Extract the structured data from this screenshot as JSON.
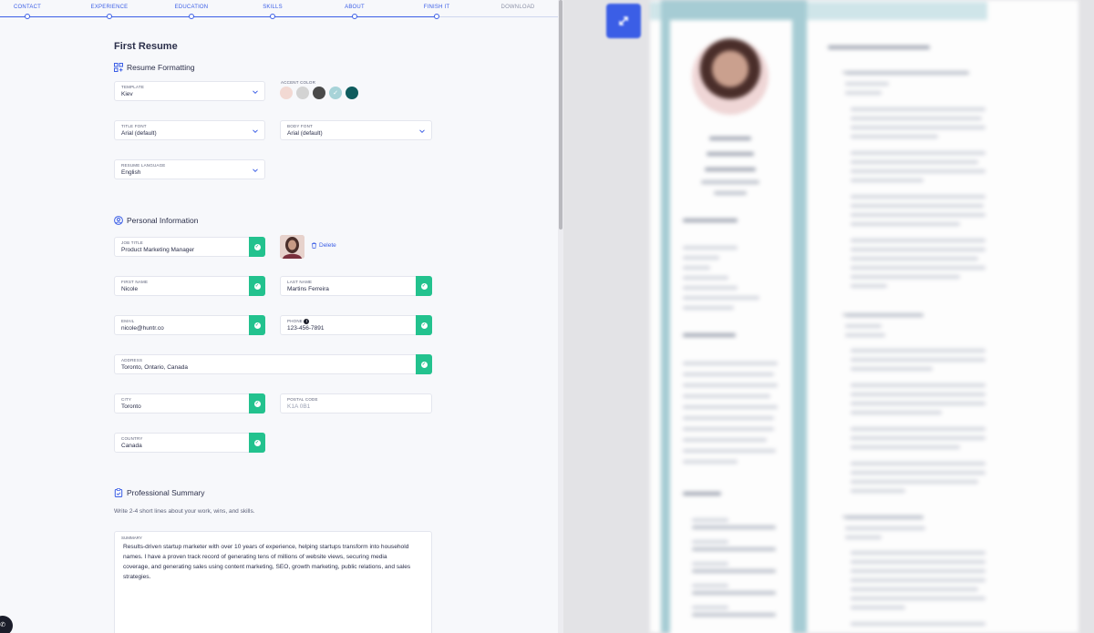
{
  "steps": [
    {
      "label": "CONTACT",
      "done": true
    },
    {
      "label": "EXPERIENCE",
      "done": true
    },
    {
      "label": "EDUCATION",
      "done": true
    },
    {
      "label": "SKILLS",
      "done": true
    },
    {
      "label": "ABOUT",
      "done": true
    },
    {
      "label": "FINISH IT",
      "done": true
    },
    {
      "label": "DOWNLOAD",
      "done": false
    }
  ],
  "page_title": "First Resume",
  "formatting": {
    "heading": "Resume Formatting",
    "template": {
      "label": "TEMPLATE",
      "value": "Kiev"
    },
    "accent": {
      "label": "ACCENT COLOR",
      "colors": [
        "#f2d9d3",
        "#d3d3d3",
        "#4a4a4a",
        "#a7d3d8",
        "#0f5c5e"
      ],
      "selected_index": 3
    },
    "title_font": {
      "label": "TITLE FONT",
      "value": "Arial (default)"
    },
    "body_font": {
      "label": "BODY FONT",
      "value": "Arial (default)"
    },
    "language": {
      "label": "RESUME LANGUAGE",
      "value": "English"
    }
  },
  "personal": {
    "heading": "Personal Information",
    "job_title": {
      "label": "JOB TITLE",
      "value": "Product Marketing Manager"
    },
    "delete_label": "Delete",
    "first_name": {
      "label": "FIRST NAME",
      "value": "Nicole"
    },
    "last_name": {
      "label": "LAST NAME",
      "value": "Martins Ferreira"
    },
    "email": {
      "label": "EMAIL",
      "value": "nicole@huntr.co"
    },
    "phone": {
      "label": "PHONE",
      "value": "123-456-7891"
    },
    "address": {
      "label": "ADDRESS",
      "value": "Toronto, Ontario, Canada"
    },
    "city": {
      "label": "CITY",
      "value": "Toronto"
    },
    "postal_code": {
      "label": "POSTAL CODE",
      "placeholder": "K1A 0B1"
    },
    "country": {
      "label": "COUNTRY",
      "value": "Canada"
    }
  },
  "summary_section": {
    "heading": "Professional Summary",
    "hint": "Write 2-4 short lines about your work, wins, and skills.",
    "label": "SUMMARY",
    "text": "Results-driven startup marketer with over 10 years of experience, helping startups transform into household names. I have a proven track record of generating tens of millions of website views, securing media coverage, and generating sales using content marketing, SEO, growth marketing, public relations, and sales strategies."
  },
  "colors": {
    "brand": "#3b5ee6",
    "success": "#23c28e",
    "text": "#2b2f4a"
  }
}
